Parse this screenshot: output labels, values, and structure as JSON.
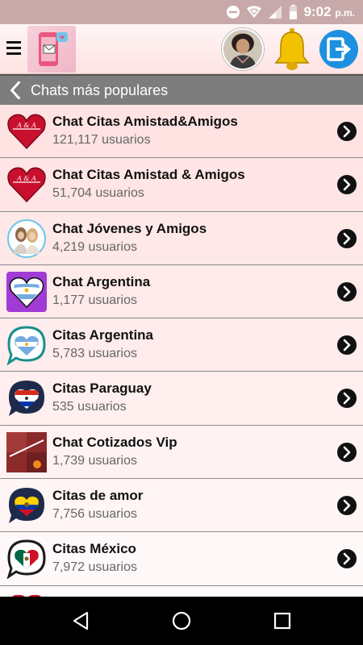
{
  "status_bar": {
    "time": "9:02",
    "ampm": "p.m.",
    "icons": [
      "do-not-disturb-icon",
      "wifi-icon",
      "signal-icon",
      "battery-icon"
    ],
    "bg": "#c8a9a9"
  },
  "app_bar": {
    "icons": [
      "menu-icon",
      "app-logo",
      "user-avatar",
      "notification-bell-icon",
      "logout-icon"
    ],
    "bell_color": "#f2c200",
    "logout_color": "#1e90e0"
  },
  "section": {
    "title": "Chats más populares",
    "back_icon": "chevron-left-icon"
  },
  "chats": [
    {
      "name": "Chat Citas Amistad&Amigos",
      "count": "121,117 usuarios",
      "icon": "red-heart-icon",
      "bg": "#ffe3e3"
    },
    {
      "name": "Chat Citas Amistad & Amigos",
      "count": "51,704 usuarios",
      "icon": "red-heart-icon",
      "bg": "#ffe5e5"
    },
    {
      "name": "Chat Jóvenes y Amigos",
      "count": "4,219 usuarios",
      "icon": "friends-photo-icon",
      "bg": "#ffe8e8"
    },
    {
      "name": "Chat Argentina",
      "count": "1,177 usuarios",
      "icon": "argentina-heart-icon",
      "bg": "#ffeaea"
    },
    {
      "name": "Citas Argentina",
      "count": "5,783 usuarios",
      "icon": "argentina-chat-heart-icon",
      "bg": "#ffecec"
    },
    {
      "name": "Citas Paraguay",
      "count": "535 usuarios",
      "icon": "paraguay-heart-icon",
      "bg": "#ffefef"
    },
    {
      "name": "Chat Cotizados Vip",
      "count": "1,739 usuarios",
      "icon": "cotizados-image-icon",
      "bg": "#fff2f2"
    },
    {
      "name": "Citas de amor",
      "count": "7,756 usuarios",
      "icon": "ecuador-heart-icon",
      "bg": "#fff5f5"
    },
    {
      "name": "Citas México",
      "count": "7,972 usuarios",
      "icon": "mexico-heart-icon",
      "bg": "#fff8f8"
    }
  ],
  "nav_bar": {
    "buttons": [
      "back-triangle-icon",
      "home-circle-icon",
      "recents-square-icon"
    ]
  }
}
